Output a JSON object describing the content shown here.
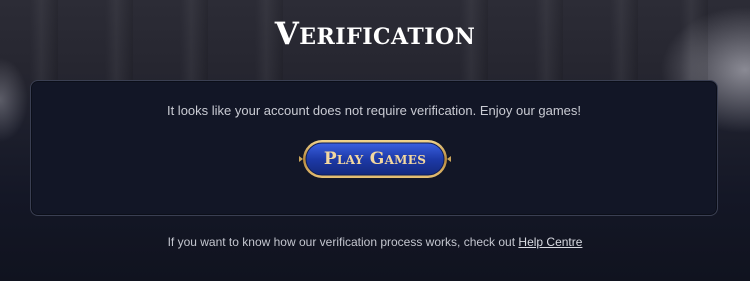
{
  "header": {
    "title": "Verification"
  },
  "card": {
    "message": "It looks like your account does not require verification. Enjoy our games!",
    "play_button_label": "Play Games"
  },
  "footer": {
    "text": "If you want to know how our verification process works, check out",
    "link_label": "Help Centre"
  },
  "colors": {
    "button_fill": "#1d3aa8",
    "button_border": "#c9a45a",
    "card_background": "#121626"
  }
}
